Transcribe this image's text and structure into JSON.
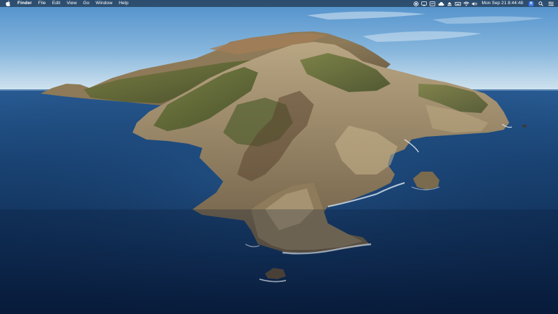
{
  "menubar": {
    "app_name": "Finder",
    "menus": [
      "File",
      "Edit",
      "View",
      "Go",
      "Window",
      "Help"
    ],
    "status_icons": [
      "record-icon",
      "display-icon",
      "screen-recording-icon",
      "cloud-icon",
      "eject-icon",
      "keyboard-icon",
      "wifi-icon",
      "volume-icon"
    ],
    "datetime": "Mon Sep 21  8:44:48",
    "user_initial": "A",
    "right_icons": [
      "spotlight-search-icon",
      "control-center-icon"
    ]
  },
  "desktop": {
    "wallpaper": "catalina-island",
    "colors": {
      "sky_top": "#5b9bd3",
      "sky_bottom": "#cfe1ee",
      "ocean_far": "#1c4a80",
      "ocean_near": "#0b2347",
      "rock": "#8a7a5c",
      "vegetation": "#5e6b30"
    }
  }
}
